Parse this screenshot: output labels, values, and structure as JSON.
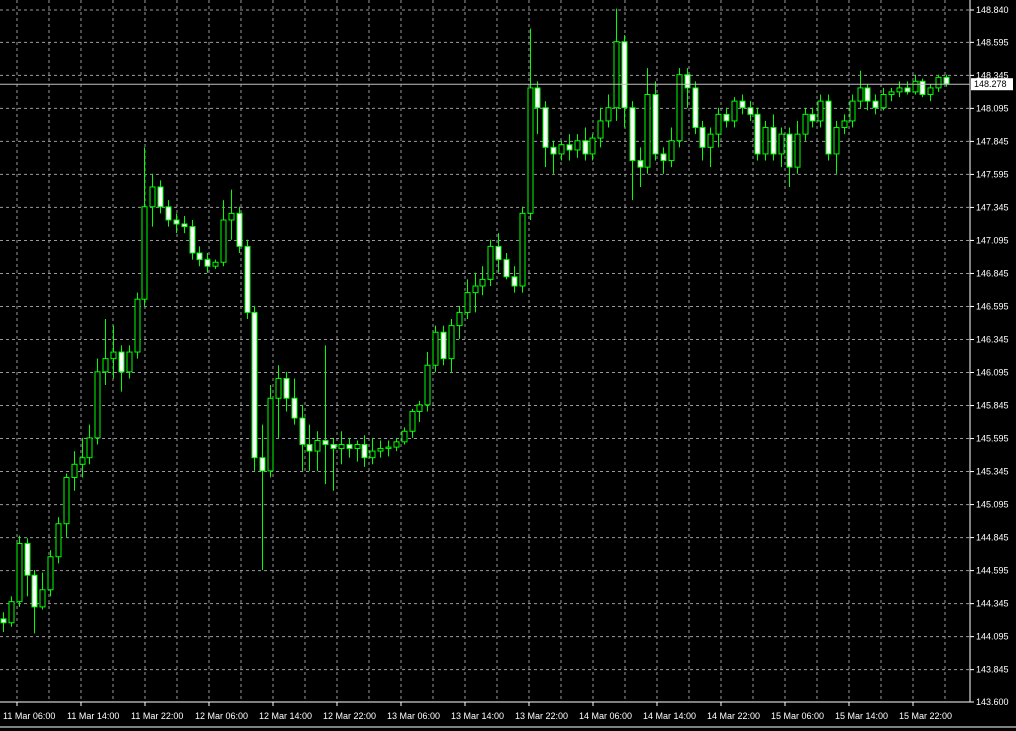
{
  "colors": {
    "background": "#000000",
    "grid": "#9a9a9a",
    "axis": "#ffffff",
    "bull_body": "#000000",
    "bear_body": "#ffffff",
    "wick": "#00ff00",
    "price_line": "#c0c0c0",
    "price_label_bg": "#ffffff"
  },
  "chart_data": {
    "type": "candlestick",
    "current_price_label": "148.278",
    "current_price": 148.278,
    "ylim": [
      143.6,
      148.84
    ],
    "y_ticks": [
      "148.840",
      "148.595",
      "148.345",
      "148.095",
      "147.845",
      "147.595",
      "147.345",
      "147.095",
      "146.845",
      "146.595",
      "146.345",
      "146.095",
      "145.845",
      "145.595",
      "145.345",
      "145.095",
      "144.845",
      "144.595",
      "144.345",
      "144.095",
      "143.845",
      "143.600"
    ],
    "x_labels": [
      "11 Mar 06:00",
      "11 Mar 14:00",
      "11 Mar 22:00",
      "12 Mar 06:00",
      "12 Mar 14:00",
      "12 Mar 22:00",
      "13 Mar 06:00",
      "13 Mar 14:00",
      "13 Mar 22:00",
      "14 Mar 06:00",
      "14 Mar 14:00",
      "14 Mar 22:00",
      "15 Mar 06:00",
      "15 Mar 14:00",
      "15 Mar 22:00"
    ],
    "grid": true,
    "candles": [
      {
        "o": 144.23,
        "h": 144.28,
        "l": 144.13,
        "c": 144.2
      },
      {
        "o": 144.2,
        "h": 144.4,
        "l": 144.17,
        "c": 144.36
      },
      {
        "o": 144.36,
        "h": 144.86,
        "l": 144.32,
        "c": 144.8
      },
      {
        "o": 144.8,
        "h": 144.84,
        "l": 144.4,
        "c": 144.56
      },
      {
        "o": 144.56,
        "h": 144.6,
        "l": 144.12,
        "c": 144.32
      },
      {
        "o": 144.32,
        "h": 144.58,
        "l": 144.3,
        "c": 144.45
      },
      {
        "o": 144.45,
        "h": 144.75,
        "l": 144.4,
        "c": 144.7
      },
      {
        "o": 144.7,
        "h": 145.0,
        "l": 144.65,
        "c": 144.95
      },
      {
        "o": 144.95,
        "h": 145.33,
        "l": 144.85,
        "c": 145.3
      },
      {
        "o": 145.3,
        "h": 145.5,
        "l": 145.2,
        "c": 145.4
      },
      {
        "o": 145.4,
        "h": 145.6,
        "l": 145.3,
        "c": 145.45
      },
      {
        "o": 145.45,
        "h": 145.7,
        "l": 145.4,
        "c": 145.6
      },
      {
        "o": 145.6,
        "h": 146.2,
        "l": 145.55,
        "c": 146.1
      },
      {
        "o": 146.1,
        "h": 146.5,
        "l": 146.0,
        "c": 146.2
      },
      {
        "o": 146.2,
        "h": 146.45,
        "l": 146.05,
        "c": 146.25
      },
      {
        "o": 146.25,
        "h": 146.3,
        "l": 145.95,
        "c": 146.1
      },
      {
        "o": 146.1,
        "h": 146.3,
        "l": 146.05,
        "c": 146.25
      },
      {
        "o": 146.25,
        "h": 146.7,
        "l": 146.2,
        "c": 146.65
      },
      {
        "o": 146.65,
        "h": 147.8,
        "l": 146.6,
        "c": 147.35
      },
      {
        "o": 147.35,
        "h": 147.6,
        "l": 147.2,
        "c": 147.5
      },
      {
        "o": 147.5,
        "h": 147.55,
        "l": 147.3,
        "c": 147.35
      },
      {
        "o": 147.35,
        "h": 147.4,
        "l": 147.2,
        "c": 147.25
      },
      {
        "o": 147.25,
        "h": 147.3,
        "l": 147.15,
        "c": 147.22
      },
      {
        "o": 147.22,
        "h": 147.28,
        "l": 147.15,
        "c": 147.2
      },
      {
        "o": 147.2,
        "h": 147.25,
        "l": 146.95,
        "c": 147.0
      },
      {
        "o": 147.0,
        "h": 147.05,
        "l": 146.9,
        "c": 146.95
      },
      {
        "o": 146.95,
        "h": 147.0,
        "l": 146.85,
        "c": 146.9
      },
      {
        "o": 146.9,
        "h": 146.95,
        "l": 146.88,
        "c": 146.93
      },
      {
        "o": 146.93,
        "h": 147.4,
        "l": 146.9,
        "c": 147.25
      },
      {
        "o": 147.25,
        "h": 147.48,
        "l": 147.1,
        "c": 147.3
      },
      {
        "o": 147.3,
        "h": 147.35,
        "l": 147.0,
        "c": 147.05
      },
      {
        "o": 147.05,
        "h": 147.1,
        "l": 146.5,
        "c": 146.55
      },
      {
        "o": 146.55,
        "h": 146.6,
        "l": 145.35,
        "c": 145.45
      },
      {
        "o": 145.45,
        "h": 145.7,
        "l": 144.6,
        "c": 145.35
      },
      {
        "o": 145.35,
        "h": 146.0,
        "l": 145.3,
        "c": 145.9
      },
      {
        "o": 145.9,
        "h": 146.15,
        "l": 145.6,
        "c": 146.05
      },
      {
        "o": 146.05,
        "h": 146.1,
        "l": 145.8,
        "c": 145.9
      },
      {
        "o": 145.9,
        "h": 146.05,
        "l": 145.7,
        "c": 145.75
      },
      {
        "o": 145.75,
        "h": 145.85,
        "l": 145.35,
        "c": 145.55
      },
      {
        "o": 145.55,
        "h": 145.7,
        "l": 145.35,
        "c": 145.5
      },
      {
        "o": 145.5,
        "h": 145.65,
        "l": 145.35,
        "c": 145.58
      },
      {
        "o": 145.58,
        "h": 146.3,
        "l": 145.25,
        "c": 145.55
      },
      {
        "o": 145.55,
        "h": 145.6,
        "l": 145.2,
        "c": 145.52
      },
      {
        "o": 145.52,
        "h": 145.65,
        "l": 145.4,
        "c": 145.55
      },
      {
        "o": 145.55,
        "h": 145.6,
        "l": 145.45,
        "c": 145.52
      },
      {
        "o": 145.52,
        "h": 145.58,
        "l": 145.42,
        "c": 145.55
      },
      {
        "o": 145.55,
        "h": 145.62,
        "l": 145.38,
        "c": 145.45
      },
      {
        "o": 145.45,
        "h": 145.6,
        "l": 145.4,
        "c": 145.5
      },
      {
        "o": 145.5,
        "h": 145.58,
        "l": 145.45,
        "c": 145.52
      },
      {
        "o": 145.52,
        "h": 145.58,
        "l": 145.46,
        "c": 145.53
      },
      {
        "o": 145.53,
        "h": 145.6,
        "l": 145.5,
        "c": 145.57
      },
      {
        "o": 145.57,
        "h": 145.68,
        "l": 145.55,
        "c": 145.65
      },
      {
        "o": 145.65,
        "h": 145.82,
        "l": 145.6,
        "c": 145.8
      },
      {
        "o": 145.8,
        "h": 145.88,
        "l": 145.72,
        "c": 145.85
      },
      {
        "o": 145.85,
        "h": 146.25,
        "l": 145.8,
        "c": 146.15
      },
      {
        "o": 146.15,
        "h": 146.45,
        "l": 146.1,
        "c": 146.4
      },
      {
        "o": 146.4,
        "h": 146.45,
        "l": 146.15,
        "c": 146.2
      },
      {
        "o": 146.2,
        "h": 146.5,
        "l": 146.1,
        "c": 146.45
      },
      {
        "o": 146.45,
        "h": 146.6,
        "l": 146.35,
        "c": 146.55
      },
      {
        "o": 146.55,
        "h": 146.8,
        "l": 146.5,
        "c": 146.7
      },
      {
        "o": 146.7,
        "h": 146.85,
        "l": 146.55,
        "c": 146.75
      },
      {
        "o": 146.75,
        "h": 146.9,
        "l": 146.68,
        "c": 146.8
      },
      {
        "o": 146.8,
        "h": 147.1,
        "l": 146.75,
        "c": 147.05
      },
      {
        "o": 147.05,
        "h": 147.15,
        "l": 146.85,
        "c": 146.95
      },
      {
        "o": 146.95,
        "h": 147.0,
        "l": 146.8,
        "c": 146.82
      },
      {
        "o": 146.82,
        "h": 146.9,
        "l": 146.7,
        "c": 146.75
      },
      {
        "o": 146.75,
        "h": 147.35,
        "l": 146.7,
        "c": 147.3
      },
      {
        "o": 147.3,
        "h": 148.7,
        "l": 147.25,
        "c": 148.25
      },
      {
        "o": 148.25,
        "h": 148.3,
        "l": 147.9,
        "c": 148.1
      },
      {
        "o": 148.1,
        "h": 148.15,
        "l": 147.65,
        "c": 147.8
      },
      {
        "o": 147.8,
        "h": 147.85,
        "l": 147.6,
        "c": 147.75
      },
      {
        "o": 147.75,
        "h": 147.85,
        "l": 147.7,
        "c": 147.82
      },
      {
        "o": 147.82,
        "h": 147.9,
        "l": 147.7,
        "c": 147.78
      },
      {
        "o": 147.78,
        "h": 147.9,
        "l": 147.72,
        "c": 147.85
      },
      {
        "o": 147.85,
        "h": 147.95,
        "l": 147.7,
        "c": 147.75
      },
      {
        "o": 147.75,
        "h": 147.9,
        "l": 147.7,
        "c": 147.87
      },
      {
        "o": 147.87,
        "h": 148.1,
        "l": 147.8,
        "c": 148.0
      },
      {
        "o": 148.0,
        "h": 148.2,
        "l": 147.95,
        "c": 148.1
      },
      {
        "o": 148.1,
        "h": 148.85,
        "l": 148.0,
        "c": 148.6
      },
      {
        "o": 148.6,
        "h": 148.65,
        "l": 147.95,
        "c": 148.1
      },
      {
        "o": 148.1,
        "h": 148.15,
        "l": 147.4,
        "c": 147.7
      },
      {
        "o": 147.7,
        "h": 147.8,
        "l": 147.5,
        "c": 147.65
      },
      {
        "o": 147.65,
        "h": 148.4,
        "l": 147.6,
        "c": 148.2
      },
      {
        "o": 148.2,
        "h": 148.3,
        "l": 147.7,
        "c": 147.75
      },
      {
        "o": 147.75,
        "h": 147.8,
        "l": 147.6,
        "c": 147.7
      },
      {
        "o": 147.7,
        "h": 147.95,
        "l": 147.65,
        "c": 147.85
      },
      {
        "o": 147.85,
        "h": 148.4,
        "l": 147.8,
        "c": 148.35
      },
      {
        "o": 148.35,
        "h": 148.4,
        "l": 148.1,
        "c": 148.25
      },
      {
        "o": 148.25,
        "h": 148.3,
        "l": 147.9,
        "c": 147.95
      },
      {
        "o": 147.95,
        "h": 148.0,
        "l": 147.7,
        "c": 147.8
      },
      {
        "o": 147.8,
        "h": 147.95,
        "l": 147.65,
        "c": 147.9
      },
      {
        "o": 147.9,
        "h": 148.1,
        "l": 147.8,
        "c": 148.05
      },
      {
        "o": 148.05,
        "h": 148.1,
        "l": 147.95,
        "c": 148.0
      },
      {
        "o": 148.0,
        "h": 148.18,
        "l": 147.95,
        "c": 148.15
      },
      {
        "o": 148.15,
        "h": 148.2,
        "l": 148.05,
        "c": 148.1
      },
      {
        "o": 148.1,
        "h": 148.15,
        "l": 148.0,
        "c": 148.05
      },
      {
        "o": 148.05,
        "h": 148.1,
        "l": 147.7,
        "c": 147.75
      },
      {
        "o": 147.75,
        "h": 148.0,
        "l": 147.7,
        "c": 147.95
      },
      {
        "o": 147.95,
        "h": 148.05,
        "l": 147.7,
        "c": 147.75
      },
      {
        "o": 147.75,
        "h": 147.95,
        "l": 147.65,
        "c": 147.9
      },
      {
        "o": 147.9,
        "h": 147.95,
        "l": 147.5,
        "c": 147.65
      },
      {
        "o": 147.65,
        "h": 148.0,
        "l": 147.6,
        "c": 147.9
      },
      {
        "o": 147.9,
        "h": 148.1,
        "l": 147.85,
        "c": 148.05
      },
      {
        "o": 148.05,
        "h": 148.1,
        "l": 147.95,
        "c": 148.0
      },
      {
        "o": 148.0,
        "h": 148.2,
        "l": 147.95,
        "c": 148.15
      },
      {
        "o": 148.15,
        "h": 148.2,
        "l": 147.7,
        "c": 147.75
      },
      {
        "o": 147.75,
        "h": 148.0,
        "l": 147.6,
        "c": 147.95
      },
      {
        "o": 147.95,
        "h": 148.05,
        "l": 147.9,
        "c": 148.0
      },
      {
        "o": 148.0,
        "h": 148.2,
        "l": 147.95,
        "c": 148.15
      },
      {
        "o": 148.15,
        "h": 148.38,
        "l": 148.1,
        "c": 148.25
      },
      {
        "o": 148.25,
        "h": 148.28,
        "l": 148.08,
        "c": 148.15
      },
      {
        "o": 148.15,
        "h": 148.2,
        "l": 148.05,
        "c": 148.1
      },
      {
        "o": 148.1,
        "h": 148.25,
        "l": 148.08,
        "c": 148.2
      },
      {
        "o": 148.2,
        "h": 148.25,
        "l": 148.15,
        "c": 148.22
      },
      {
        "o": 148.22,
        "h": 148.3,
        "l": 148.18,
        "c": 148.25
      },
      {
        "o": 148.25,
        "h": 148.3,
        "l": 148.2,
        "c": 148.22
      },
      {
        "o": 148.22,
        "h": 148.35,
        "l": 148.2,
        "c": 148.3
      },
      {
        "o": 148.3,
        "h": 148.32,
        "l": 148.18,
        "c": 148.2
      },
      {
        "o": 148.2,
        "h": 148.28,
        "l": 148.15,
        "c": 148.25
      },
      {
        "o": 148.25,
        "h": 148.35,
        "l": 148.22,
        "c": 148.33
      },
      {
        "o": 148.33,
        "h": 148.35,
        "l": 148.26,
        "c": 148.28
      }
    ]
  }
}
